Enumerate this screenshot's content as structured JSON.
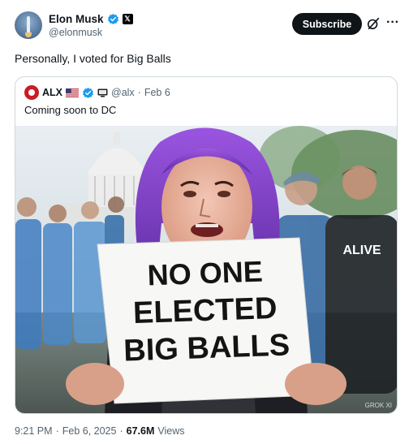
{
  "author": {
    "display_name": "Elon Musk",
    "handle": "@elonmusk",
    "avatar_icon": "rocket-launch-avatar",
    "verified_icon": "verified-badge-icon",
    "affiliation_icon": "x-logo-icon"
  },
  "actions": {
    "subscribe_label": "Subscribe",
    "grok_icon": "grok-icon",
    "more_icon": "more-icon"
  },
  "post": {
    "text": "Personally, I voted for Big Balls",
    "time": "9:21 PM",
    "date": "Feb 6, 2025",
    "views_count": "67.6M",
    "views_label": "Views"
  },
  "quote": {
    "display_name": "ALX",
    "handle": "@alx",
    "date": "Feb 6",
    "text": "Coming soon to DC",
    "image": {
      "sign_lines": [
        "NO ONE",
        "ELECTED",
        "BIG BALLS"
      ],
      "shirt_text": "ALIVE",
      "watermark": "GROK XI"
    }
  },
  "colors": {
    "text": "#0f1419",
    "secondary": "#536471",
    "border": "#cfd9de",
    "verified": "#1d9bf0",
    "button": "#0f1419",
    "hair": "#7b3fc4"
  }
}
